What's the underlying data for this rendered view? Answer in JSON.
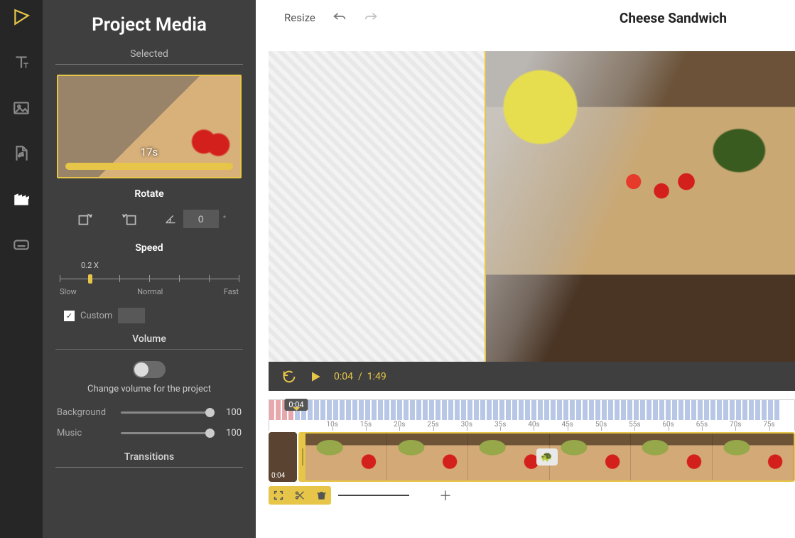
{
  "rail": {
    "items": [
      "brand",
      "text",
      "image",
      "audio",
      "video",
      "subtitle"
    ]
  },
  "panel": {
    "title": "Project Media",
    "selected_label": "Selected",
    "clip_duration": "17s",
    "rotate_label": "Rotate",
    "rotate_angle": "0",
    "rotate_unit": "°",
    "speed_label": "Speed",
    "speed_value": "0.2 X",
    "speed_slow": "Slow",
    "speed_normal": "Normal",
    "speed_fast": "Fast",
    "custom_checked": "✓",
    "custom_label": "Custom",
    "volume_label": "Volume",
    "volume_caption": "Change volume for the project",
    "background_label": "Background",
    "background_value": "100",
    "music_label": "Music",
    "music_value": "100",
    "transitions_label": "Transitions"
  },
  "topbar": {
    "resize": "Resize",
    "project_name": "Cheese Sandwich"
  },
  "player": {
    "current": "0:04",
    "sep": "/",
    "total": "1:49"
  },
  "timeline": {
    "playhead": "0:04",
    "preclip_time": "0:04",
    "ticks": [
      "10s",
      "15s",
      "20s",
      "25s",
      "30s",
      "35s",
      "40s",
      "45s",
      "50s",
      "55s",
      "60s",
      "65s",
      "70s",
      "75s"
    ]
  },
  "colors": {
    "accent": "#e6c548",
    "panel": "#3f3f3f",
    "rail": "#262626"
  }
}
